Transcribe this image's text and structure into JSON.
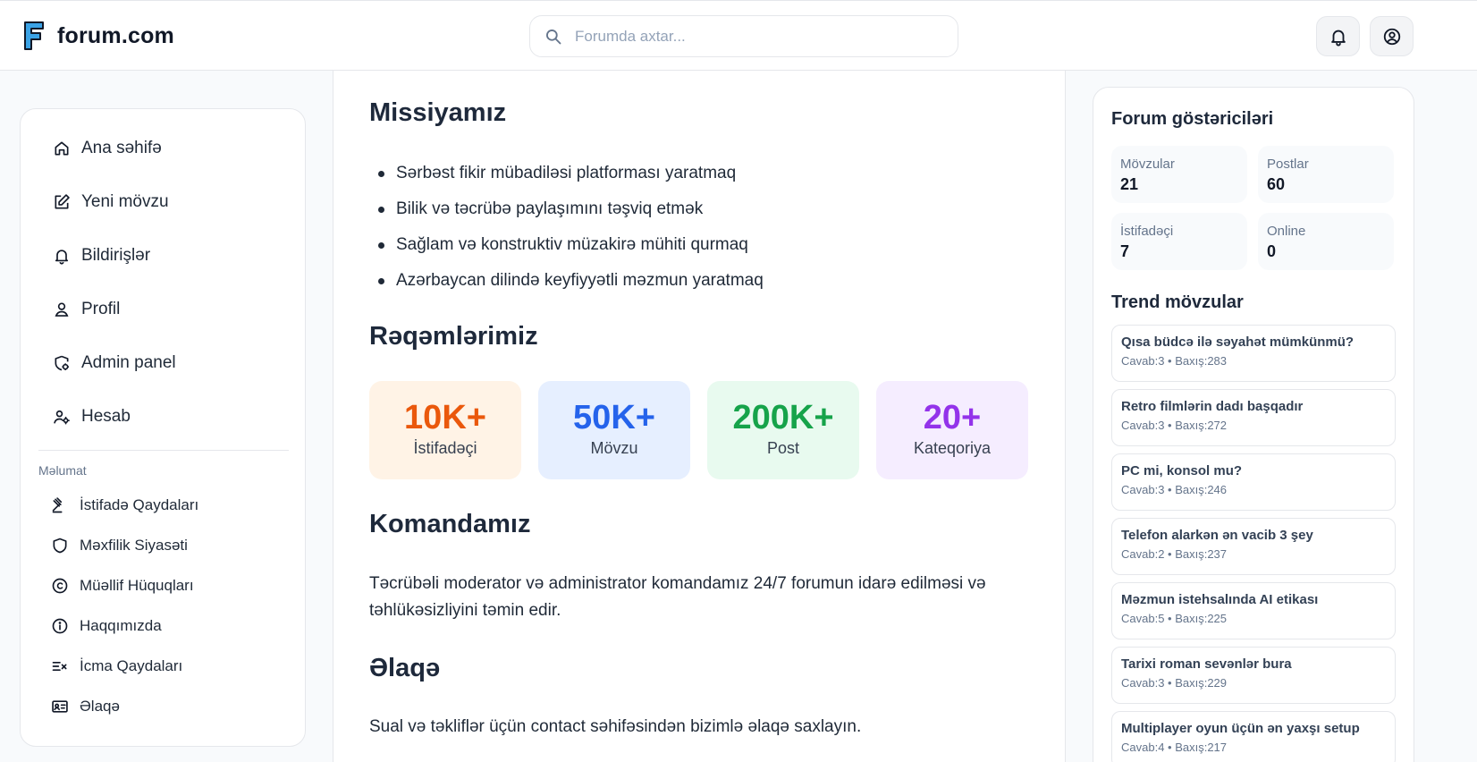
{
  "header": {
    "logo_letter": "F",
    "logo_text": "forum.com",
    "search_placeholder": "Forumda axtar..."
  },
  "sidebar": {
    "nav": [
      {
        "label": "Ana səhifə",
        "icon": "home-icon"
      },
      {
        "label": "Yeni mövzu",
        "icon": "edit-icon"
      },
      {
        "label": "Bildirişlər",
        "icon": "bell-icon"
      },
      {
        "label": "Profil",
        "icon": "user-icon"
      },
      {
        "label": "Admin panel",
        "icon": "shield-gear-icon"
      },
      {
        "label": "Hesab",
        "icon": "user-gear-icon"
      }
    ],
    "section_label": "Məlumat",
    "info": [
      {
        "label": "İstifadə Qaydaları",
        "icon": "gavel-icon"
      },
      {
        "label": "Məxfilik Siyasəti",
        "icon": "shield-icon"
      },
      {
        "label": "Müəllif Hüquqları",
        "icon": "copyright-icon"
      },
      {
        "label": "Haqqımızda",
        "icon": "info-icon"
      },
      {
        "label": "İcma Qaydaları",
        "icon": "list-check-icon"
      },
      {
        "label": "Əlaqə",
        "icon": "contact-card-icon"
      }
    ]
  },
  "main": {
    "mission_title": "Missiyamız",
    "mission_items": [
      "Sərbəst fikir mübadiləsi platforması yaratmaq",
      "Bilik və təcrübə paylaşımını təşviq etmək",
      "Sağlam və konstruktiv müzakirə mühiti qurmaq",
      "Azərbaycan dilində keyfiyyətli məzmun yaratmaq"
    ],
    "numbers_title": "Rəqəmlərimiz",
    "stats": [
      {
        "value": "10K+",
        "label": "İstifadəçi",
        "color": "#ea580c",
        "bg": "#fff3e6"
      },
      {
        "value": "50K+",
        "label": "Mövzu",
        "color": "#2563eb",
        "bg": "#e6efff"
      },
      {
        "value": "200K+",
        "label": "Post",
        "color": "#16a34a",
        "bg": "#e8faef"
      },
      {
        "value": "20+",
        "label": "Kateqoriya",
        "color": "#9333ea",
        "bg": "#f5edff"
      }
    ],
    "team_title": "Komandamız",
    "team_text": "Təcrübəli moderator və administrator komandamız 24/7 forumun idarə edilməsi və təhlükəsizliyini təmin edir.",
    "contact_title": "Əlaqə",
    "contact_text": "Sual və təkliflər üçün contact səhifəsindən bizimlə əlaqə saxlayın."
  },
  "rightbar": {
    "stats_title": "Forum göstəriciləri",
    "stats": [
      {
        "label": "Mövzular",
        "value": "21"
      },
      {
        "label": "Postlar",
        "value": "60"
      },
      {
        "label": "İstifadəçi",
        "value": "7"
      },
      {
        "label": "Online",
        "value": "0"
      }
    ],
    "trend_title": "Trend mövzular",
    "trends": [
      {
        "title": "Qısa büdcə ilə səyahət mümkünmü?",
        "meta": "Cavab:3 • Baxış:283"
      },
      {
        "title": "Retro filmlərin dadı başqadır",
        "meta": "Cavab:3 • Baxış:272"
      },
      {
        "title": "PC mi, konsol mu?",
        "meta": "Cavab:3 • Baxış:246"
      },
      {
        "title": "Telefon alarkən ən vacib 3 şey",
        "meta": "Cavab:2 • Baxış:237"
      },
      {
        "title": "Məzmun istehsalında AI etikası",
        "meta": "Cavab:5 • Baxış:225"
      },
      {
        "title": "Tarixi roman sevənlər bura",
        "meta": "Cavab:3 • Baxış:229"
      },
      {
        "title": "Multiplayer oyun üçün ən yaxşı setup",
        "meta": "Cavab:4 • Baxış:217"
      }
    ]
  }
}
